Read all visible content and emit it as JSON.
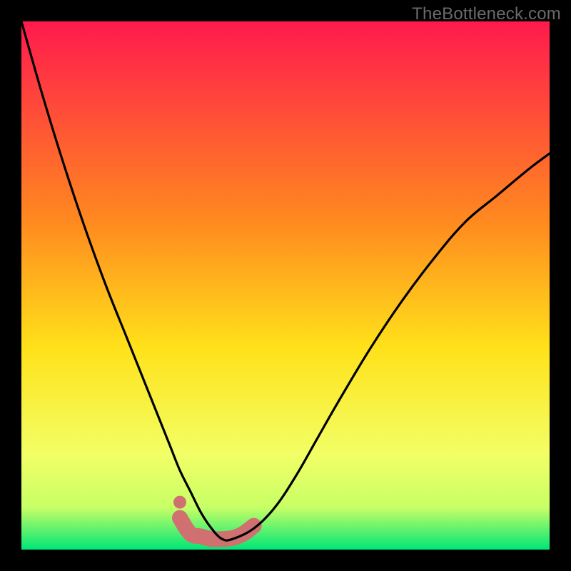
{
  "watermark": "TheBottleneck.com",
  "chart_data": {
    "type": "line",
    "title": "",
    "xlabel": "",
    "ylabel": "",
    "xlim": [
      0,
      100
    ],
    "ylim": [
      0,
      100
    ],
    "grid": false,
    "legend": false,
    "series": [
      {
        "name": "bottleneck-curve",
        "x": [
          0,
          4,
          8,
          12,
          16,
          20,
          24,
          28,
          30,
          32,
          34,
          36,
          38,
          40,
          44,
          48,
          52,
          56,
          60,
          66,
          72,
          78,
          84,
          90,
          96,
          100
        ],
        "y": [
          100,
          86,
          73,
          61,
          50,
          40,
          30,
          20,
          15,
          11,
          7,
          4,
          2,
          2,
          4,
          8,
          14,
          21,
          28,
          38,
          47,
          55,
          62,
          67,
          72,
          75
        ]
      },
      {
        "name": "highlight-band",
        "x": [
          30,
          32,
          34,
          36,
          38,
          40,
          42,
          44
        ],
        "y": [
          6,
          3,
          2.5,
          2,
          2,
          2.2,
          3,
          4.5
        ]
      }
    ],
    "colors": {
      "gradient_top": "#ff1a4d",
      "gradient_mid1": "#ff8a1f",
      "gradient_mid2": "#ffe21a",
      "gradient_mid3": "#f2ff66",
      "gradient_bottom": "#00e676",
      "curve": "#000000",
      "highlight": "#d07070",
      "background": "#000000",
      "watermark": "#6a6a6a"
    }
  }
}
